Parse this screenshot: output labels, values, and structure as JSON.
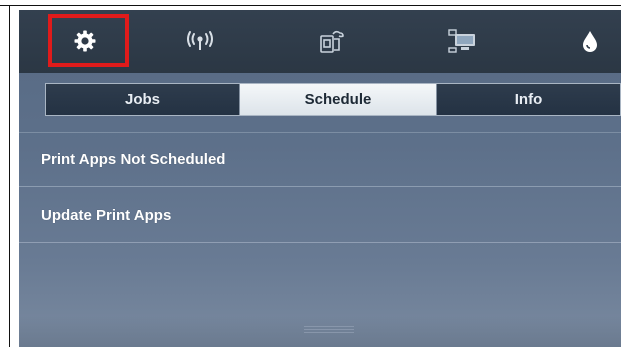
{
  "toolbar": {
    "icons": [
      "settings-icon",
      "wireless-icon",
      "cloud-print-icon",
      "network-icon",
      "ink-icon"
    ],
    "highlight_color": "#e01b1b"
  },
  "tabs": [
    {
      "label": "Jobs",
      "selected": false
    },
    {
      "label": "Schedule",
      "selected": true
    },
    {
      "label": "Info",
      "selected": false
    }
  ],
  "list": [
    {
      "label": "Print Apps Not Scheduled"
    },
    {
      "label": "Update Print Apps"
    }
  ],
  "colors": {
    "screen_bg": "#5d708a",
    "toolbar_bg": "#2f3b49",
    "tab_selected_bg": "#eef2f5"
  }
}
